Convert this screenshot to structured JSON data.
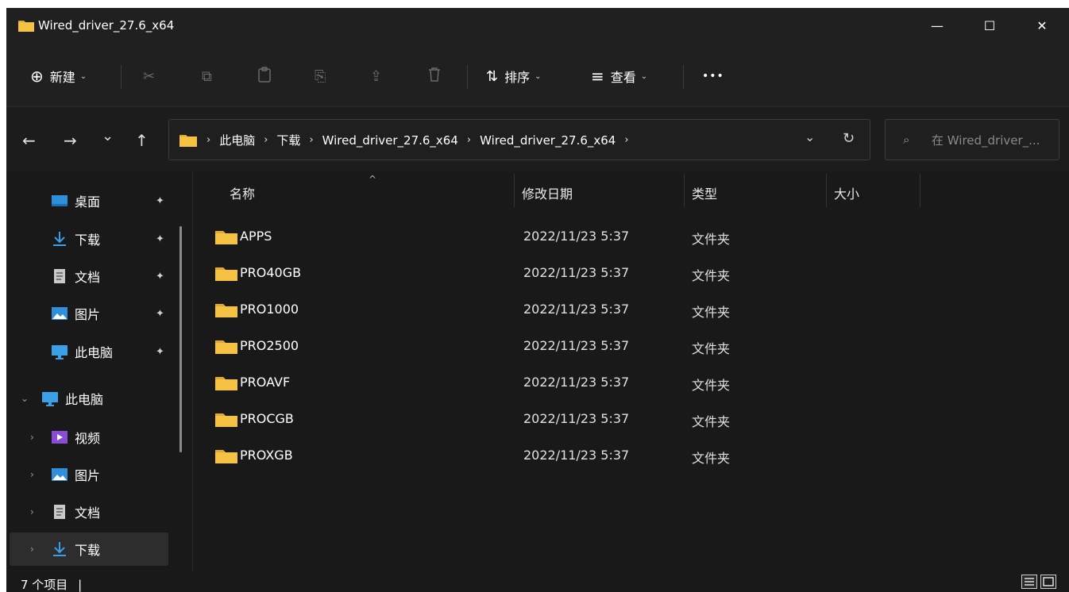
{
  "window": {
    "title": "Wired_driver_27.6_x64",
    "minimize_glyph": "—",
    "maximize_glyph": "☐",
    "close_glyph": "✕"
  },
  "toolbar": {
    "new_label": "新建",
    "new_icon": "⊕",
    "sort_label": "排序",
    "sort_icon": "⇅",
    "view_label": "查看",
    "view_icon": "≡",
    "more_label": "•••",
    "cut_icon": "✂",
    "copy_icon": "⧉",
    "paste_icon": "📋",
    "rename_icon": "⎘",
    "share_icon": "⇪",
    "delete_icon": "🗑"
  },
  "nav": {
    "back_icon": "←",
    "forward_icon": "→",
    "recent_icon": "⌄",
    "up_icon": "↑",
    "breadcrumbs": [
      "此电脑",
      "下载",
      "Wired_driver_27.6_x64",
      "Wired_driver_27.6_x64"
    ],
    "dropdown_icon": "⌄",
    "refresh_icon": "↻",
    "search_placeholder": "在 Wired_driver_...",
    "search_icon": "⌕"
  },
  "sidebar": {
    "quick_access": [
      {
        "label": "桌面",
        "icon": "desktop-icon",
        "color": "#2f8fdb"
      },
      {
        "label": "下载",
        "icon": "download-icon",
        "color": "#39a0e8"
      },
      {
        "label": "文档",
        "icon": "document-icon",
        "color": "#c8c8c8"
      },
      {
        "label": "图片",
        "icon": "pictures-icon",
        "color": "#2f8fdb"
      },
      {
        "label": "此电脑",
        "icon": "computer-icon",
        "color": "#3aa0e8"
      }
    ],
    "this_pc": {
      "label": "此电脑",
      "expander": "⌄"
    },
    "children": [
      {
        "label": "视频",
        "icon": "videos-icon",
        "color": "#8a4bd6"
      },
      {
        "label": "图片",
        "icon": "pictures-icon",
        "color": "#2f8fdb"
      },
      {
        "label": "文档",
        "icon": "document-icon",
        "color": "#c8c8c8"
      },
      {
        "label": "下载",
        "icon": "download-icon",
        "color": "#39a0e8"
      }
    ],
    "pin_glyph": "📌",
    "collapsed_glyph": "›"
  },
  "columns": {
    "name": "名称",
    "date": "修改日期",
    "type": "类型",
    "size": "大小",
    "sort_indicator": "^"
  },
  "files": [
    {
      "name": "APPS",
      "date": "2022/11/23 5:37",
      "type": "文件夹"
    },
    {
      "name": "PRO40GB",
      "date": "2022/11/23 5:37",
      "type": "文件夹"
    },
    {
      "name": "PRO1000",
      "date": "2022/11/23 5:37",
      "type": "文件夹"
    },
    {
      "name": "PRO2500",
      "date": "2022/11/23 5:37",
      "type": "文件夹"
    },
    {
      "name": "PROAVF",
      "date": "2022/11/23 5:37",
      "type": "文件夹"
    },
    {
      "name": "PROCGB",
      "date": "2022/11/23 5:37",
      "type": "文件夹"
    },
    {
      "name": "PROXGB",
      "date": "2022/11/23 5:37",
      "type": "文件夹"
    }
  ],
  "status": {
    "item_count": "7 个项目",
    "separator": "|"
  },
  "colors": {
    "folder": "#f5c243",
    "folder_tab": "#e0a82e",
    "background": "#191919",
    "chrome": "#202020"
  }
}
